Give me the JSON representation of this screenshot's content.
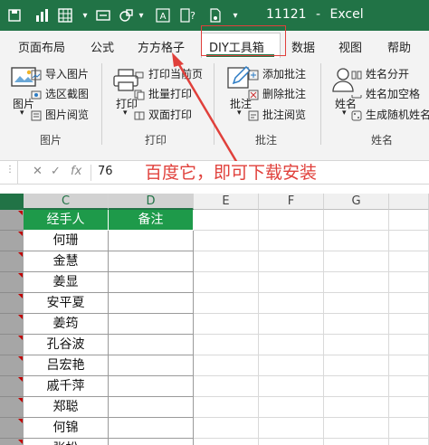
{
  "app": {
    "doc_name": "11121",
    "separator": "-",
    "app_name": "Excel"
  },
  "tabs": [
    "页面布局",
    "公式",
    "方方格子",
    "DIY工具箱",
    "数据",
    "视图",
    "帮助"
  ],
  "ribbon": {
    "picture_group": {
      "label": "图片",
      "big_button": "图片",
      "items": [
        "导入图片",
        "选区截图",
        "图片阅览"
      ]
    },
    "print_group": {
      "label": "打印",
      "big_button": "打印",
      "items": [
        "打印当前页",
        "批量打印",
        "双面打印"
      ]
    },
    "comment_group": {
      "label": "批注",
      "big_button": "批注",
      "items": [
        "添加批注",
        "删除批注",
        "批注阅览"
      ]
    },
    "name_group": {
      "label": "姓名",
      "big_button": "姓名",
      "items": [
        "姓名分开",
        "姓名加空格",
        "生成随机姓名"
      ]
    }
  },
  "formula_bar": {
    "cancel_symbol": "✕",
    "enter_symbol": "✓",
    "fx_symbol": "fx",
    "value": "76"
  },
  "annotation": {
    "text": "百度它，即可下载安装",
    "color": "#e0403b"
  },
  "columns": [
    "C",
    "D",
    "E",
    "F",
    "G"
  ],
  "table": {
    "headers": [
      "经手人",
      "备注"
    ],
    "rows": [
      "何珊",
      "金慧",
      "姜显",
      "安平夏",
      "姜筠",
      "孔谷波",
      "吕宏艳",
      "戚千萍",
      "郑聪",
      "何锦",
      "张松"
    ]
  },
  "colors": {
    "excel_green": "#217346",
    "header_fill": "#1e9a4a",
    "annotation_red": "#e0403b"
  }
}
